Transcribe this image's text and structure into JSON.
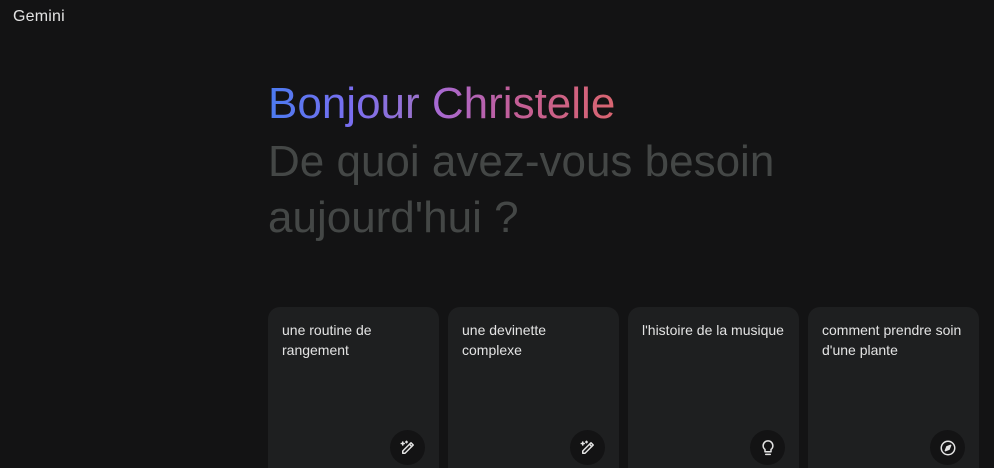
{
  "app": {
    "title": "Gemini"
  },
  "hero": {
    "greeting_word1": "Bonjour",
    "greeting_word2": "Christelle",
    "subtitle": "De quoi avez-vous besoin aujourd'hui ?"
  },
  "cards": [
    {
      "text": "une routine de rangement",
      "icon": "pencil-sparkle-icon"
    },
    {
      "text": "une devinette complexe",
      "icon": "pencil-sparkle-icon"
    },
    {
      "text": "l'histoire de la musique",
      "icon": "lightbulb-icon"
    },
    {
      "text": "comment prendre soin d'une plante",
      "icon": "compass-icon"
    }
  ],
  "colors": {
    "background": "#131314",
    "card": "#1e1f20",
    "subtitle": "#444746",
    "gradient_blue": "#4b7bf0",
    "gradient_purple": "#9b72cb",
    "gradient_red": "#d96570"
  }
}
